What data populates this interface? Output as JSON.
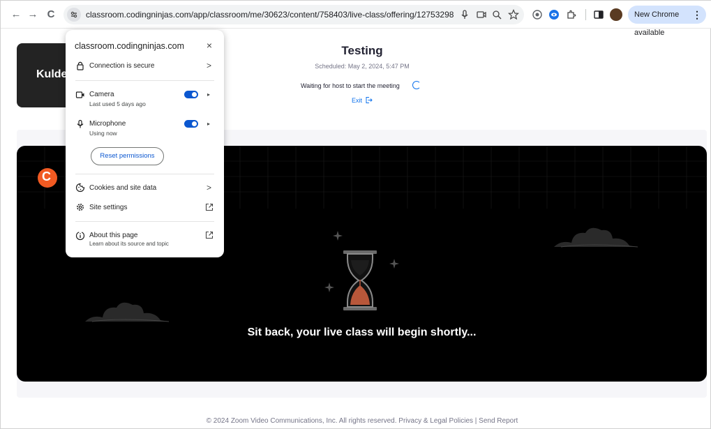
{
  "browser": {
    "url": "classroom.codingninjas.com/app/classroom/me/30623/content/758403/live-class/offering/12753298",
    "update_label": "New Chrome available",
    "more_icon": "⋮",
    "back_icon": "←",
    "forward_icon": "→",
    "reload_icon": "C"
  },
  "site_popup": {
    "domain": "classroom.codingninjas.com",
    "close_icon": "×",
    "connection_label": "Connection is secure",
    "camera_label": "Camera",
    "camera_sub": "Last used 5 days ago",
    "camera_enabled": true,
    "microphone_label": "Microphone",
    "microphone_sub": "Using now",
    "microphone_enabled": true,
    "reset_label": "Reset permissions",
    "cookies_label": "Cookies and site data",
    "site_settings_label": "Site settings",
    "about_label": "About this page",
    "about_sub": "Learn about its source and topic",
    "chevron": ">",
    "caret": "▸"
  },
  "meeting": {
    "participant_name": "Kulde",
    "title": "Testing",
    "scheduled": "Scheduled: May 2, 2024, 5:47 PM",
    "waiting": "Waiting for host to start the meeting",
    "exit_label": "Exit"
  },
  "banner": {
    "logo_letter": "C",
    "message": "Sit back, your live class will begin shortly..."
  },
  "footer": {
    "text": "© 2024 Zoom Video Communications, Inc. All rights reserved. Privacy & Legal Policies  |  Send Report"
  },
  "colors": {
    "accent": "#0b57d0",
    "zoom_blue": "#0e72ed",
    "brand_orange": "#f15a22",
    "hourglass_sand": "#b8573a"
  }
}
